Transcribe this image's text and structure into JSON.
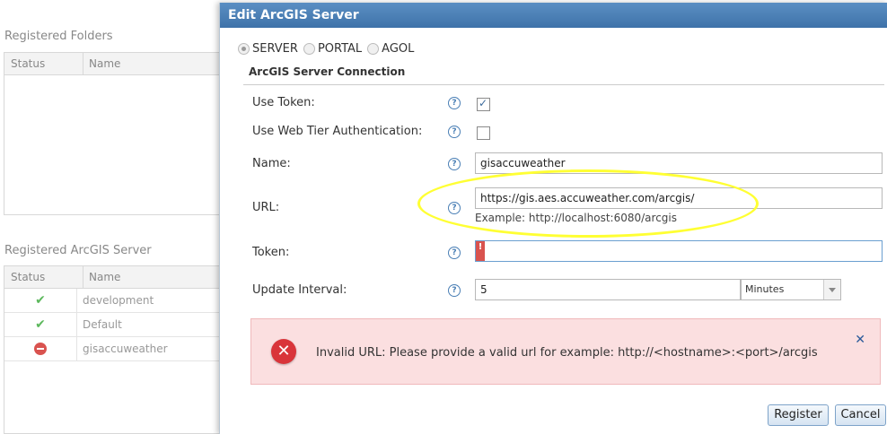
{
  "background": {
    "folders": {
      "title": "Registered Folders",
      "col_status": "Status",
      "col_name": "Name"
    },
    "servers": {
      "title": "Registered ArcGIS Server",
      "col_status": "Status",
      "col_name": "Name",
      "rows": [
        {
          "status_icon": "check-icon",
          "name": "development"
        },
        {
          "status_icon": "check-icon",
          "name": "Default"
        },
        {
          "status_icon": "no-entry-icon",
          "name": "gisaccuweather"
        }
      ]
    }
  },
  "dialog": {
    "title": "Edit ArcGIS Server",
    "type_options": [
      {
        "label": "SERVER",
        "selected": true
      },
      {
        "label": "PORTAL",
        "selected": false
      },
      {
        "label": "AGOL",
        "selected": false
      }
    ],
    "section_title": "ArcGIS Server Connection",
    "fields": {
      "use_token": {
        "label": "Use Token:",
        "checked": true
      },
      "use_web_tier": {
        "label": "Use Web Tier Authentication:",
        "checked": false
      },
      "name": {
        "label": "Name:",
        "value": "gisaccuweather"
      },
      "url": {
        "label": "URL:",
        "value": "https://gis.aes.accuweather.com/arcgis/",
        "example": "Example: http://localhost:6080/arcgis"
      },
      "token": {
        "label": "Token:",
        "value": "",
        "error_marker": "!"
      },
      "update_interval": {
        "label": "Update Interval:",
        "value": "5",
        "unit": "Minutes"
      }
    },
    "help_glyph": "?",
    "error": {
      "icon": "error-icon",
      "glyph": "✕",
      "message": "Invalid URL: Please provide a valid url for example: http://<hostname>:<port>/arcgis",
      "close_glyph": "✕"
    },
    "buttons": {
      "register": "Register",
      "cancel": "Cancel"
    }
  },
  "colors": {
    "titlebar": "#4a7fb5",
    "error_bg": "#fbdfe0",
    "error_icon": "#d9343a",
    "highlight": "#ffff33"
  }
}
